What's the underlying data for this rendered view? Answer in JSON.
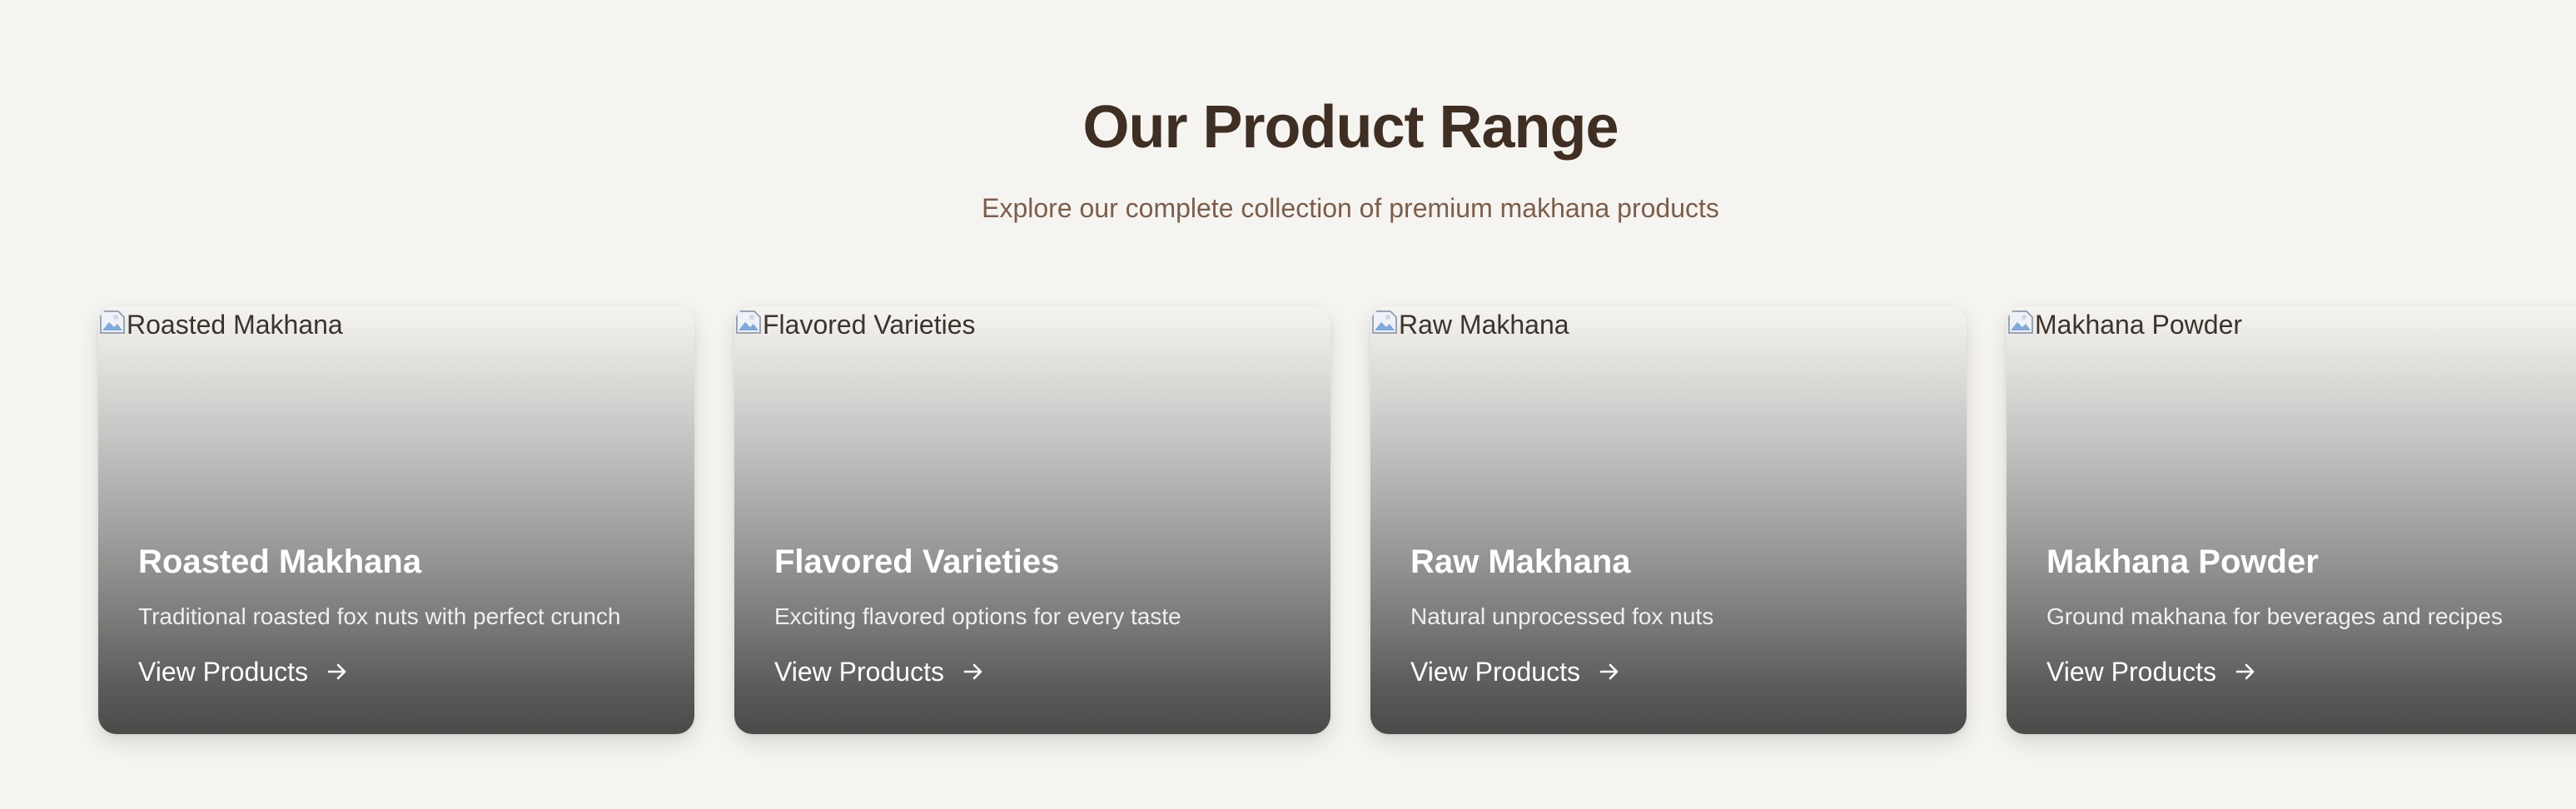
{
  "section": {
    "title": "Our Product Range",
    "subtitle": "Explore our complete collection of premium makhana products"
  },
  "cards": [
    {
      "image_alt": "Roasted Makhana",
      "title": "Roasted Makhana",
      "description": "Traditional roasted fox nuts with perfect crunch",
      "link_label": "View Products",
      "link_icon": "arrow-right-icon"
    },
    {
      "image_alt": "Flavored Varieties",
      "title": "Flavored Varieties",
      "description": "Exciting flavored options for every taste",
      "link_label": "View Products",
      "link_icon": "arrow-right-icon"
    },
    {
      "image_alt": "Raw Makhana",
      "title": "Raw Makhana",
      "description": "Natural unprocessed fox nuts",
      "link_label": "View Products",
      "link_icon": "arrow-right-icon"
    },
    {
      "image_alt": "Makhana Powder",
      "title": "Makhana Powder",
      "description": "Ground makhana for beverages and recipes",
      "link_label": "View Products",
      "link_icon": "arrow-right-icon"
    }
  ],
  "colors": {
    "background": "#f6f4f0",
    "heading": "#3f2e23",
    "subheading": "#7b5e4d",
    "card_text": "#ffffff"
  }
}
